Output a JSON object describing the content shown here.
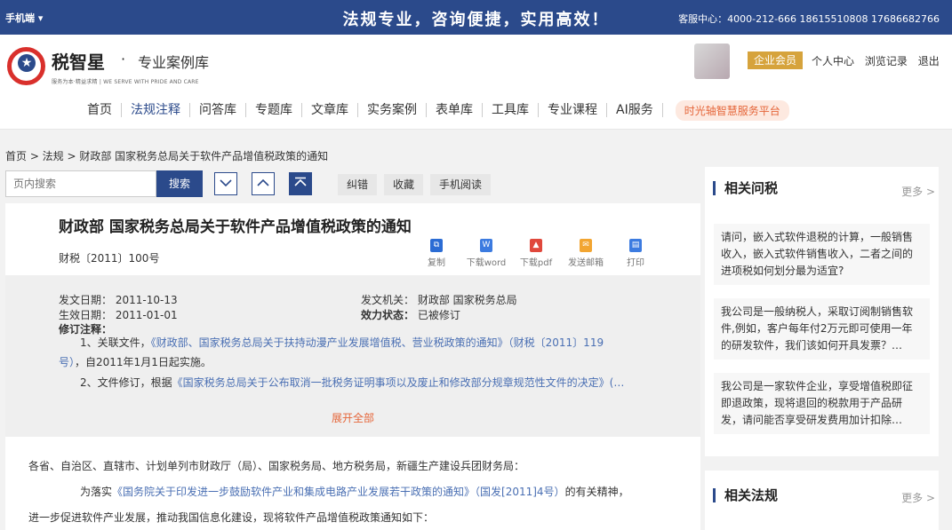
{
  "topbar": {
    "mobile": "手机端 ▾",
    "slogan": "法规专业，咨询便捷，实用高效！",
    "contact": "客服中心：4000-212-666 18615510808 17686682766"
  },
  "brand": {
    "name": "税智星",
    "dot": "·",
    "subtitle": "专业案例库",
    "tagline": "服务为本·精益求精 | WE SERVE WITH PRIDE AND CARE"
  },
  "user": {
    "vip": "企业会员",
    "links": [
      "个人中心",
      "浏览记录",
      "退出"
    ]
  },
  "nav": {
    "items": [
      "首页",
      "法规注释",
      "问答库",
      "专题库",
      "文章库",
      "实务案例",
      "表单库",
      "工具库",
      "专业课程",
      "AI服务"
    ],
    "active": "法规注释",
    "platform": "时光轴智慧服务平台"
  },
  "breadcrumb": "首页 > 法规 > 财政部 国家税务总局关于软件产品增值税政策的通知",
  "toolbar": {
    "search_placeholder": "页内搜索",
    "search_label": "搜索",
    "down_icon": "chevron-down-icon",
    "up_icon": "chevron-up-icon",
    "top_icon": "back-to-top-icon",
    "correct": "纠错",
    "favorite": "收藏",
    "mobile_read": "手机阅读"
  },
  "doc": {
    "title": "财政部 国家税务总局关于软件产品增值税政策的通知",
    "number": "财税〔2011〕100号",
    "actions": [
      {
        "label": "复制",
        "color": "#2b6cd4"
      },
      {
        "label": "下载word",
        "color": "#3c7be0"
      },
      {
        "label": "下载pdf",
        "color": "#e0483c"
      },
      {
        "label": "发送邮箱",
        "color": "#f2a531"
      },
      {
        "label": "打印",
        "color": "#3c7be0"
      }
    ],
    "meta": {
      "issue_date_label": "发文日期：",
      "issue_date": "2011-10-13",
      "effective_date_label": "生效日期：",
      "effective_date": "2011-01-01",
      "issuer_label": "发文机关：",
      "issuer": "财政部 国家税务总局",
      "status_label": "效力状态：",
      "status": "已被修订",
      "notes_label": "修订注释："
    },
    "notes": {
      "n1_prefix": "1、关联文件，",
      "n1_link": "《财政部、国家税务总局关于扶持动漫产业发展增值税、营业税政策的通知》（财税〔2011〕119",
      "n1_link2": "号）",
      "n1_suffix": "，自2011年1月1日起实施。",
      "n2_prefix": "2、文件修订，根据",
      "n2_link": "《国家税务总局关于公布取消一批税务证明事项以及废止和修改部分规章规范性文件的决定》(…"
    },
    "expand": "展开全部",
    "body": {
      "salutation": "各省、自治区、直辖市、计划单列市财政厅（局）、国家税务局、地方税务局，新疆生产建设兵团财务局：",
      "p1_prefix": "为落实",
      "p1_link": "《国务院关于印发进一步鼓励软件产业和集成电路产业发展若干政策的通知》（国发[2011]4号）",
      "p1_suffix": "的有关精神，",
      "p1_line2": "进一步促进软件产业发展，推动我国信息化建设，现将软件产品增值税政策通知如下："
    }
  },
  "sidebar": {
    "qa_title": "相关问税",
    "more": "更多 >",
    "qa_items": [
      "请问，嵌入式软件退税的计算，一般销售收入，嵌入式软件销售收入，二者之间的进项税如何划分最为适宜?",
      "我公司是一般纳税人，采取订阅制销售软件,例如，客户每年付2万元即可使用一年的研发软件，我们该如何开具发票？…",
      "我公司是一家软件企业，享受增值税即征即退政策，现将退回的税款用于产品研发，请问能否享受研发费用加计扣除…"
    ],
    "law_title": "相关法规"
  }
}
